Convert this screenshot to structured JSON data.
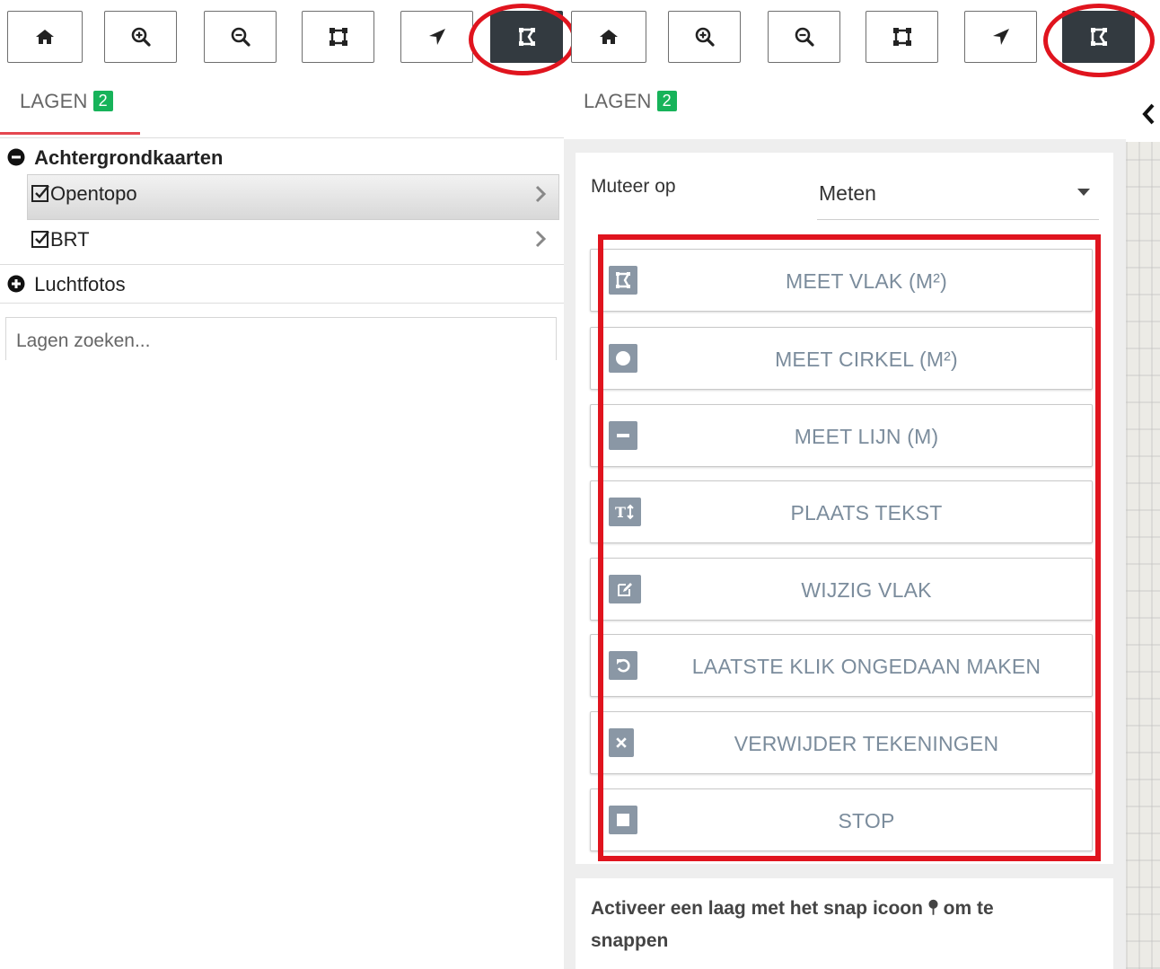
{
  "toolbar": {
    "buttons": [
      {
        "icon": "home-icon"
      },
      {
        "icon": "zoom-in-icon"
      },
      {
        "icon": "zoom-out-icon"
      },
      {
        "icon": "full-extent-icon"
      },
      {
        "icon": "locate-arrow-icon"
      },
      {
        "icon": "measure-tool-icon",
        "active": true
      }
    ],
    "highlight_color": "#e0141e",
    "active_color": "#333a40"
  },
  "left_panel": {
    "tab_label": "LAGEN",
    "tab_badge": "2",
    "groups": [
      {
        "label": "Achtergrondkaarten",
        "expanded": true,
        "items": [
          {
            "label": "Opentopo",
            "checked": true,
            "selected": true
          },
          {
            "label": "BRT",
            "checked": true
          }
        ]
      },
      {
        "label": "Luchtfotos",
        "expanded": false
      }
    ],
    "search_placeholder": "Lagen zoeken..."
  },
  "right_panel": {
    "tab_label": "LAGEN",
    "tab_badge": "2",
    "mutate_label": "Muteer op",
    "mutate_value": "Meten",
    "buttons": [
      {
        "label": "MEET VLAK (M²)",
        "icon": "polygon-icon"
      },
      {
        "label": "MEET CIRKEL (M²)",
        "icon": "circle-icon"
      },
      {
        "label": "MEET LIJN (M)",
        "icon": "line-icon"
      },
      {
        "label": "PLAATS TEKST",
        "icon": "text-icon"
      },
      {
        "label": "WIJZIG VLAK",
        "icon": "edit-icon"
      },
      {
        "label": "LAATSTE KLIK ONGEDAAN MAKEN",
        "icon": "undo-icon"
      },
      {
        "label": "VERWIJDER TEKENINGEN",
        "icon": "delete-icon"
      },
      {
        "label": "STOP",
        "icon": "stop-icon"
      }
    ],
    "snap_text_before": "Activeer een laag met het snap icoon",
    "snap_text_after": "om te",
    "snap_text_line2": "snappen"
  },
  "colors": {
    "badge": "#17b35a",
    "button_text": "#7b8c9c",
    "icon_bg": "#8a97a5",
    "annotation": "#e0141e"
  }
}
